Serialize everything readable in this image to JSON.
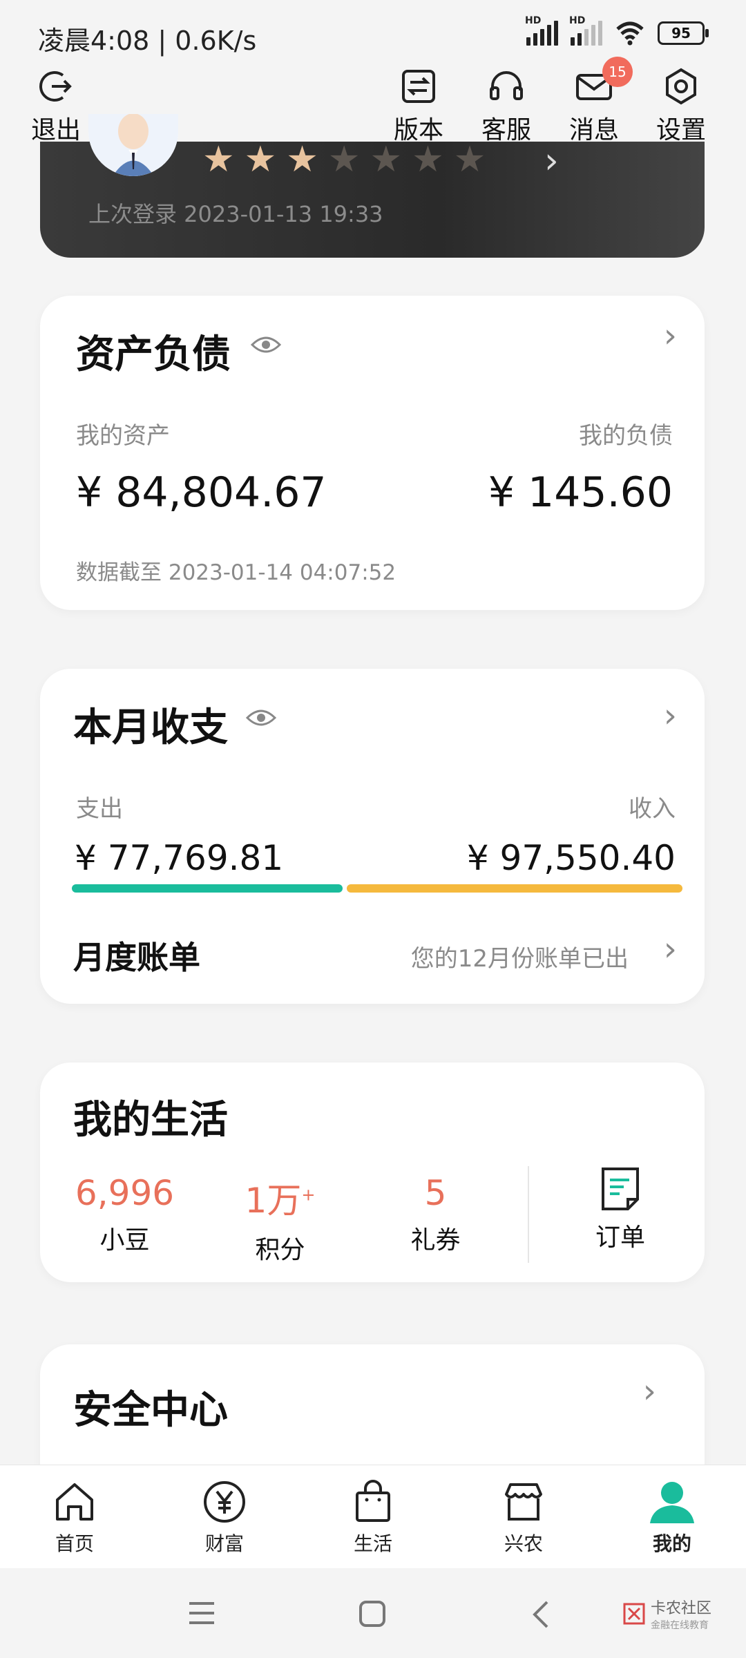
{
  "status_bar": {
    "time_speed": "凌晨4:08 | 0.6K/s",
    "hd1": "HD",
    "hd2": "HD",
    "battery": "95"
  },
  "top_bar": {
    "logout": "退出",
    "version": "版本",
    "service": "客服",
    "messages": "消息",
    "messages_badge": "15",
    "settings": "设置"
  },
  "profile": {
    "rating": 3,
    "rating_max": 7,
    "last_login": "上次登录 2023-01-13 19:33"
  },
  "assets": {
    "title": "资产负债",
    "my_assets_label": "我的资产",
    "my_assets_value": "¥ 84,804.67",
    "my_liabilities_label": "我的负债",
    "my_liabilities_value": "¥ 145.60",
    "data_as_of": "数据截至 2023-01-14 04:07:52"
  },
  "monthly": {
    "title": "本月收支",
    "expense_label": "支出",
    "expense_value": "¥ 77,769.81",
    "income_label": "收入",
    "income_value": "¥ 97,550.40",
    "expense_share": 0.4437,
    "bill_title": "月度账单",
    "bill_note": "您的12月份账单已出"
  },
  "life": {
    "title": "我的生活",
    "items": [
      {
        "value": "6,996",
        "label": "小豆"
      },
      {
        "value": "1万",
        "sup": "+",
        "label": "积分"
      },
      {
        "value": "5",
        "label": "礼券"
      }
    ],
    "orders_label": "订单"
  },
  "security": {
    "title": "安全中心"
  },
  "bottom_nav": {
    "items": [
      {
        "label": "首页",
        "icon": "home-icon"
      },
      {
        "label": "财富",
        "icon": "yen-icon"
      },
      {
        "label": "生活",
        "icon": "bag-icon"
      },
      {
        "label": "兴农",
        "icon": "store-icon"
      },
      {
        "label": "我的",
        "icon": "user-icon",
        "active": true
      }
    ]
  },
  "watermark": {
    "name": "卡农社区",
    "tagline": "金融在线教育"
  },
  "colors": {
    "accent": "#1abc9c",
    "income": "#f5b93d",
    "number_red": "#e8705a",
    "badge": "#f16b5c"
  }
}
